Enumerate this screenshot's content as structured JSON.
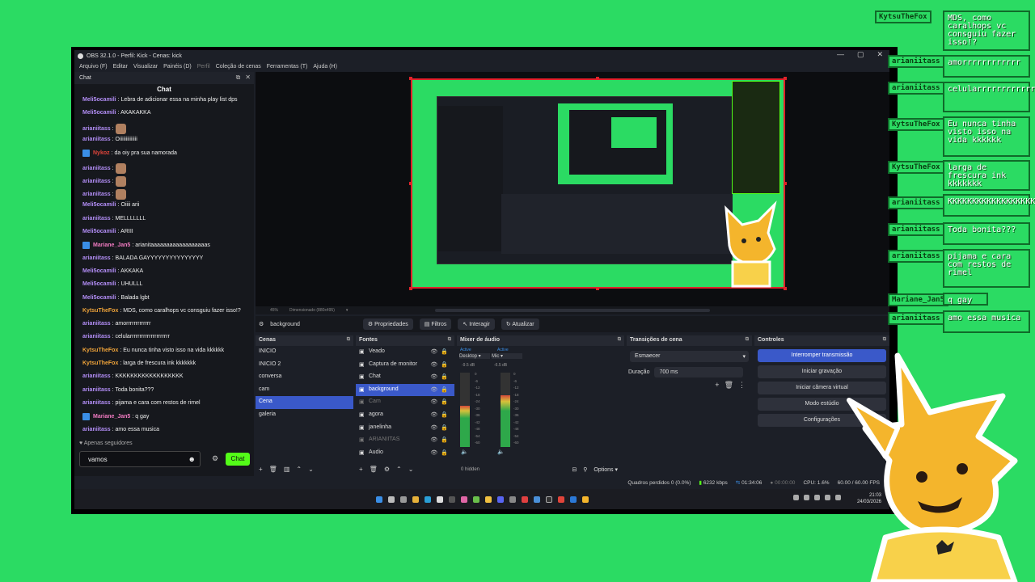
{
  "window": {
    "title": "OBS 32.1.0 - Perfil: Kick - Cenas: kick",
    "controls": [
      "—",
      "▢",
      "✕"
    ]
  },
  "menu": [
    "Arquivo (F)",
    "Editar",
    "Visualizar",
    "Painéis (D)",
    "Perfil",
    "Coleção de cenas",
    "Ferramentas (T)",
    "Ajuda (H)"
  ],
  "chat": {
    "dock_title": "Chat",
    "panel_title": "Chat",
    "messages": [
      {
        "user": "Meli5ocamili",
        "color": "#b28df5",
        "text": ": Lebra de adicionar essa na minha play list dps",
        "badge": false,
        "emote": false
      },
      {
        "user": "Meli5ocamili",
        "color": "#b28df5",
        "text": ": AKAKAKKA",
        "badge": false,
        "emote": false
      },
      {
        "user": "arianiitass",
        "color": "#b28df5",
        "text": ":",
        "badge": false,
        "emote": true
      },
      {
        "user": "arianiitass",
        "color": "#b28df5",
        "text": ": Oiiiiiiiiiiiiii",
        "badge": false,
        "emote": false
      },
      {
        "user": "Nykoz",
        "color": "#e0443a",
        "text": ": da oiy pra sua namorada",
        "badge": true,
        "emote": false
      },
      {
        "user": "arianiitass",
        "color": "#b28df5",
        "text": ":",
        "badge": false,
        "emote": true
      },
      {
        "user": "arianiitass",
        "color": "#b28df5",
        "text": ":",
        "badge": false,
        "emote": true
      },
      {
        "user": "arianiitass",
        "color": "#b28df5",
        "text": ":",
        "badge": false,
        "emote": true
      },
      {
        "user": "Meli5ocamili",
        "color": "#b28df5",
        "text": ": Oiiii arii",
        "badge": false,
        "emote": false
      },
      {
        "user": "arianiitass",
        "color": "#b28df5",
        "text": ": MELLLLLLL",
        "badge": false,
        "emote": false
      },
      {
        "user": "Meli5ocamili",
        "color": "#b28df5",
        "text": ": ARIII",
        "badge": false,
        "emote": false
      },
      {
        "user": "Mariane_Jan5",
        "color": "#f07ac0",
        "text": ": arianitaaaaaaaaaaaaaaaaaas",
        "badge": true,
        "emote": false
      },
      {
        "user": "arianiitass",
        "color": "#b28df5",
        "text": ": BALADA GAYYYYYYYYYYYYYYY",
        "badge": false,
        "emote": false
      },
      {
        "user": "Meli5ocamili",
        "color": "#b28df5",
        "text": ": AKKAKA",
        "badge": false,
        "emote": false
      },
      {
        "user": "Meli5ocamili",
        "color": "#b28df5",
        "text": ": UHULLL",
        "badge": false,
        "emote": false
      },
      {
        "user": "Meli5ocamili",
        "color": "#b28df5",
        "text": ": Balada lgbt",
        "badge": false,
        "emote": false
      },
      {
        "user": "KytsuTheFox",
        "color": "#f0a43a",
        "text": ": MDS, como caralhops vc consguiu fazer isso!?",
        "badge": false,
        "emote": false
      },
      {
        "user": "arianiitass",
        "color": "#b28df5",
        "text": ": amorrrrrrrrrrrrr",
        "badge": false,
        "emote": false
      },
      {
        "user": "arianiitass",
        "color": "#b28df5",
        "text": ": celularrrrrrrrrrrrrrrrrrrrr",
        "badge": false,
        "emote": false
      },
      {
        "user": "KytsuTheFox",
        "color": "#f0a43a",
        "text": ": Eu nunca tinha visto isso na vida kkkkkk",
        "badge": false,
        "emote": false
      },
      {
        "user": "KytsuTheFox",
        "color": "#f0a43a",
        "text": ": larga de frescura ink kkkkkkk",
        "badge": false,
        "emote": false
      },
      {
        "user": "arianiitass",
        "color": "#b28df5",
        "text": ": KKKKKKKKKKKKKKKKKK",
        "badge": false,
        "emote": false
      },
      {
        "user": "arianiitass",
        "color": "#b28df5",
        "text": ": Toda bonita???",
        "badge": false,
        "emote": false
      },
      {
        "user": "arianiitass",
        "color": "#b28df5",
        "text": ": pijama e cara com restos de rimel",
        "badge": false,
        "emote": false
      },
      {
        "user": "Mariane_Jan5",
        "color": "#f07ac0",
        "text": ": q gay",
        "badge": true,
        "emote": false
      },
      {
        "user": "arianiitass",
        "color": "#b28df5",
        "text": ": amo essa musica",
        "badge": false,
        "emote": false
      }
    ],
    "followers_note": "♥ Apenas seguidores",
    "input_value": "vamos",
    "send_label": "Chat"
  },
  "zoom": {
    "percent": "45%",
    "dims": "Dimensionado (880x495)"
  },
  "source_toolbar": {
    "source": "background",
    "props": "Propriedades",
    "filters": "Filtros",
    "interact": "Interagir",
    "refresh": "Atualizar"
  },
  "scenes": {
    "title": "Cenas",
    "items": [
      "INICIO",
      "INICIO 2",
      "conversa",
      "cam",
      "Cena",
      "galeria"
    ],
    "selected": 4
  },
  "sources": {
    "title": "Fontes",
    "items": [
      {
        "name": "Veado",
        "dim": false
      },
      {
        "name": "Captura de monitor",
        "dim": false
      },
      {
        "name": "Chat",
        "dim": false
      },
      {
        "name": "background",
        "dim": false,
        "selected": true
      },
      {
        "name": "Cam",
        "dim": true
      },
      {
        "name": "agora",
        "dim": false
      },
      {
        "name": "janelinha",
        "dim": false
      },
      {
        "name": "ARIANIITAS",
        "dim": true
      },
      {
        "name": "Audio",
        "dim": false
      }
    ]
  },
  "mixer": {
    "title": "Mixer de áudio",
    "channels": [
      {
        "status": "Active",
        "name": "Desktop",
        "db": "-9.5 dB",
        "level": 0.55
      },
      {
        "status": "Active",
        "name": "Mic",
        "db": "-6.5 dB",
        "level": 0.7
      }
    ],
    "scale": [
      "0",
      "-6",
      "-12",
      "-18",
      "-24",
      "-30",
      "-36",
      "-42",
      "-48",
      "-54",
      "-60"
    ],
    "hidden": "0 hidden",
    "options": "Options"
  },
  "transitions": {
    "title": "Transições de cena",
    "type": "Esmaecer",
    "duration_label": "Duração",
    "duration": "700 ms"
  },
  "controls": {
    "title": "Controles",
    "buttons": [
      "Interromper transmissão",
      "Iniciar gravação",
      "Iniciar câmera virtual",
      "Modo estúdio",
      "Configurações"
    ]
  },
  "status": {
    "frames": "Quadros perdidos 0 (0.0%)",
    "kbps": "6232 kbps",
    "live": "01:34:06",
    "rec": "00:00:00",
    "cpu": "CPU: 1.6%",
    "fps": "60.00 / 60.00 FPS"
  },
  "taskbar": {
    "time": "21:03",
    "date": "24/03/2026"
  },
  "overlay": {
    "names": [
      "KytsuTheFox",
      "arianiitass",
      "arianiitass",
      "KytsuTheFox",
      "KytsuTheFox",
      "arianiitass",
      "arianiitass",
      "arianiitass",
      "Mariane_Jan5",
      "arianiitass"
    ],
    "messages": [
      "MDS, como caralhops vc consguiu fazer isso!?",
      "amorrrrrrrrrrrr",
      "celularrrrrrrrrrrrrrrrrrrrr",
      "Eu nunca tinha visto isso na vida kkkkkk",
      "larga de frescura ink kkkkkkk",
      "KKKKKKKKKKKKKKKKKK",
      "Toda bonita???",
      "pijama e cara com restos de rimel",
      "q gay",
      "amo essa musica"
    ]
  },
  "colors": {
    "bg_green": "#2bdb63",
    "kick_green": "#53fc18",
    "accent_blue": "#3a59c9",
    "selection_red": "#e0232a"
  }
}
